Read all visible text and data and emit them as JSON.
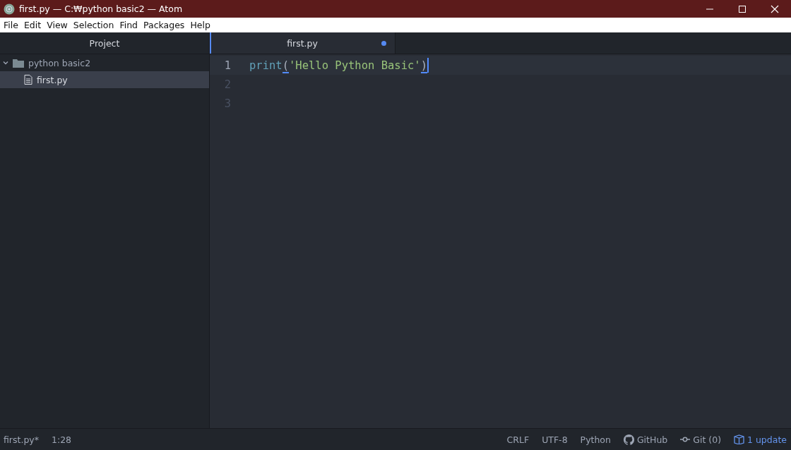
{
  "window": {
    "title": "first.py — C:₩python basic2 — Atom"
  },
  "menu": [
    "File",
    "Edit",
    "View",
    "Selection",
    "Find",
    "Packages",
    "Help"
  ],
  "project_panel": {
    "title": "Project",
    "tree": [
      {
        "kind": "folder",
        "label": "python basic2",
        "expanded": true,
        "selected": false,
        "children": [
          {
            "kind": "file",
            "label": "first.py",
            "selected": true
          }
        ]
      }
    ]
  },
  "tabs": [
    {
      "label": "first.py",
      "selected": true,
      "modified": true
    }
  ],
  "editor": {
    "lines": [
      {
        "number": "1",
        "current": true,
        "tokens": [
          {
            "kind": "function",
            "text": "print"
          },
          {
            "kind": "bracket",
            "text": "("
          },
          {
            "kind": "string",
            "text": "'Hello Python Basic'"
          },
          {
            "kind": "bracket",
            "text": ")"
          }
        ]
      },
      {
        "number": "2",
        "current": false
      },
      {
        "number": "3",
        "current": false
      }
    ]
  },
  "status_bar": {
    "file_name": "first.py*",
    "cursor_position": "1:28",
    "right": [
      {
        "kind": "text",
        "text": "CRLF"
      },
      {
        "kind": "text",
        "text": "UTF-8"
      },
      {
        "kind": "text",
        "text": "Python"
      },
      {
        "kind": "github",
        "text": "GitHub"
      },
      {
        "kind": "git",
        "text": "Git (0)"
      },
      {
        "kind": "update",
        "text": "1 update"
      }
    ]
  }
}
